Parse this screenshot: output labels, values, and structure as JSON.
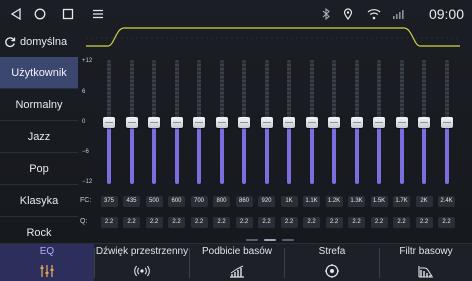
{
  "status": {
    "time": "09:00",
    "icons": [
      "back-icon",
      "home-icon",
      "menu-icon",
      "bluetooth-icon",
      "location-icon",
      "wifi-icon",
      "signal-icon"
    ]
  },
  "preset_header": {
    "label": "domyślna",
    "icon": "reset-icon"
  },
  "presets": [
    {
      "label": "Użytkownik",
      "active": true
    },
    {
      "label": "Normalny",
      "active": false
    },
    {
      "label": "Jazz",
      "active": false
    },
    {
      "label": "Pop",
      "active": false
    },
    {
      "label": "Klasyka",
      "active": false
    },
    {
      "label": "Rock",
      "active": false
    }
  ],
  "eq": {
    "gain_ticks": [
      "+12",
      "6",
      "0",
      "−6",
      "−12"
    ],
    "gain_range": [
      -12,
      12
    ],
    "fc_label": "FC:",
    "q_label": "Q:",
    "bands": [
      {
        "fc": "375",
        "q": "2.2",
        "gain": 0
      },
      {
        "fc": "435",
        "q": "2.2",
        "gain": 0
      },
      {
        "fc": "500",
        "q": "2.2",
        "gain": 0
      },
      {
        "fc": "600",
        "q": "2.2",
        "gain": 0
      },
      {
        "fc": "700",
        "q": "2.2",
        "gain": 0
      },
      {
        "fc": "800",
        "q": "2.2",
        "gain": 0
      },
      {
        "fc": "860",
        "q": "2.2",
        "gain": 0
      },
      {
        "fc": "920",
        "q": "2.2",
        "gain": 0
      },
      {
        "fc": "1K",
        "q": "2.2",
        "gain": 0
      },
      {
        "fc": "1.1K",
        "q": "2.2",
        "gain": 0
      },
      {
        "fc": "1.2K",
        "q": "2.2",
        "gain": 0
      },
      {
        "fc": "1.3K",
        "q": "2.2",
        "gain": 0
      },
      {
        "fc": "1.5K",
        "q": "2.2",
        "gain": 0
      },
      {
        "fc": "1.7K",
        "q": "2.2",
        "gain": 0
      },
      {
        "fc": "2K",
        "q": "2.2",
        "gain": 0
      },
      {
        "fc": "2.4K",
        "q": "2.2",
        "gain": 0
      }
    ],
    "page_count": 3,
    "current_page": 2
  },
  "tabs": [
    {
      "label": "EQ",
      "icon": "eq-sliders-icon",
      "active": true
    },
    {
      "label": "Dźwięk przestrzenny",
      "icon": "surround-icon",
      "active": false
    },
    {
      "label": "Podbicie basów",
      "icon": "bass-boost-icon",
      "active": false
    },
    {
      "label": "Strefa",
      "icon": "zone-icon",
      "active": false
    },
    {
      "label": "Filtr basowy",
      "icon": "bass-filter-icon",
      "active": false
    }
  ],
  "colors": {
    "accent": "#7b6fe0",
    "active_preset": "#3c4770",
    "active_tab": "#2c2f5c",
    "curve": "#d6d24a"
  }
}
